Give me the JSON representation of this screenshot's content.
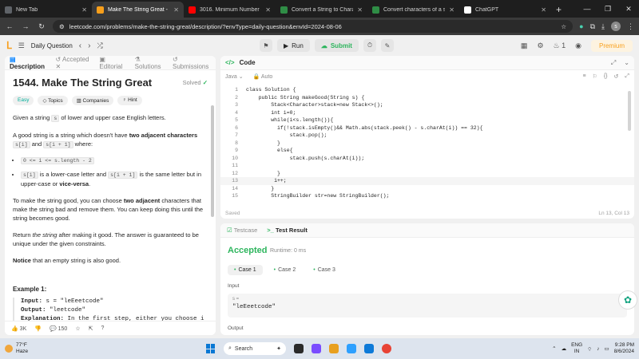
{
  "browser": {
    "tabs": [
      {
        "title": "New Tab",
        "color": "#5f6368",
        "active": false
      },
      {
        "title": "Make The String Great - Le",
        "color": "#f89f1b",
        "active": true
      },
      {
        "title": "3016. Minimum Number of P",
        "color": "#ff0000",
        "active": false
      },
      {
        "title": "Convert a String to Charac",
        "color": "#2f8d46",
        "active": false
      },
      {
        "title": "Convert characters of a str",
        "color": "#2f8d46",
        "active": false
      },
      {
        "title": "ChatGPT",
        "color": "#ffffff",
        "active": false
      }
    ],
    "url": "leetcode.com/problems/make-the-string-great/description/?envType=daily-question&envId=2024-08-06",
    "profile_initial": "s"
  },
  "lc_header": {
    "daily_label": "Daily Question",
    "run_label": "Run",
    "submit_label": "Submit",
    "notif_count": "1",
    "premium_label": "Premium"
  },
  "left_tabs": [
    "Description",
    "Accepted",
    "Editorial",
    "Solutions",
    "Submissions"
  ],
  "problem": {
    "title": "1544. Make The String Great",
    "status": "Solved",
    "chips": [
      "Easy",
      "Topics",
      "Companies",
      "Hint"
    ],
    "p1_a": "Given a string ",
    "p1_code": "s",
    "p1_b": " of lower and upper case English letters.",
    "p2_a": "A good string is a string which doesn't have ",
    "p2_bold": "two adjacent characters",
    "p2_code1": "s[i]",
    "p2_and": " and ",
    "p2_code2": "s[i + 1]",
    "p2_where": " where:",
    "c1": "0 <= i <= s.length - 2",
    "c2_code1": "s[i]",
    "c2_a": " is a lower-case letter and ",
    "c2_code2": "s[i + 1]",
    "c2_b": " is the same letter but in upper-case or ",
    "c2_bold": "vice-versa",
    "c2_end": ".",
    "p3_a": "To make the string good, you can choose ",
    "p3_bold": "two adjacent",
    "p3_b": " characters that make the string bad and remove them. You can keep doing this until the string becomes good.",
    "p4_a": "Return ",
    "p4_it": "the string",
    "p4_b": " after making it good. The answer is guaranteed to be unique under the given constraints.",
    "p5_bold": "Notice",
    "p5_b": " that an empty string is also good.",
    "example_heading": "Example 1:",
    "ex_input_label": "Input:",
    "ex_input": " s = \"leEeetcode\"",
    "ex_output_label": "Output:",
    "ex_output": " \"leetcode\"",
    "ex_expl_label": "Explanation:",
    "ex_expl": " In the first step, either you choose i",
    "likes": "3K",
    "comments": "150"
  },
  "code_panel": {
    "title": "Code",
    "language": "Java",
    "auto": "Auto",
    "saved": "Saved",
    "cursor": "Ln 13, Col 13",
    "lines": [
      "class Solution {",
      "    public String makeGood(String s) {",
      "        Stack<Character>stack=new Stack<>();",
      "        int i=0;",
      "        while(i<s.length()){",
      "          if(!stack.isEmpty()&& Math.abs(stack.peek() - s.charAt(i)) == 32){",
      "              stack.pop();",
      "          }",
      "          else{",
      "              stack.push(s.charAt(i));",
      "",
      "          }",
      "         i++;",
      "        }",
      "        StringBuilder str=new StringBuilder();"
    ]
  },
  "test_panel": {
    "tab1": "Testcase",
    "tab2": "Test Result",
    "verdict": "Accepted",
    "runtime": "Runtime: 0 ms",
    "cases": [
      "Case 1",
      "Case 2",
      "Case 3"
    ],
    "input_label": "Input",
    "var": "s =",
    "value": "\"leEeetcode\"",
    "output_label": "Output"
  },
  "taskbar": {
    "temp": "77°F",
    "weather": "Haze",
    "search": "Search",
    "lang": "ENG",
    "region": "IN",
    "time": "9:28 PM",
    "date": "8/6/2024"
  }
}
